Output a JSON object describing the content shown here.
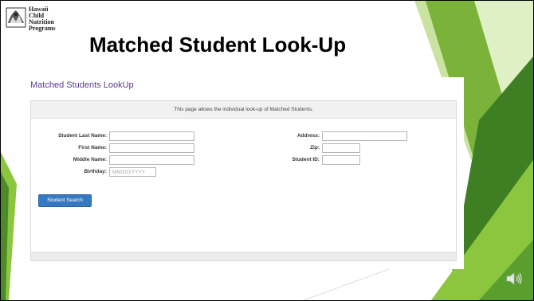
{
  "slide": {
    "title": "Matched Student Look-Up",
    "logo_lines": [
      "Hawaii",
      "Child",
      "Nutrition",
      "Programs"
    ]
  },
  "page": {
    "heading": "Matched Students LookUp",
    "panel_notice": "This page allows the individual look-up of Matched Students.",
    "fields": {
      "last_name": {
        "label": "Student Last Name:",
        "value": ""
      },
      "first_name": {
        "label": "First Name:",
        "value": ""
      },
      "middle_name": {
        "label": "Middle Name:",
        "value": ""
      },
      "birthday": {
        "label": "Birthday:",
        "placeholder": "MM/DD/YYYY"
      },
      "address": {
        "label": "Address:",
        "value": ""
      },
      "zip": {
        "label": "Zip:",
        "value": ""
      },
      "student_id": {
        "label": "Student ID:",
        "value": ""
      }
    },
    "search_button": "Student Search"
  },
  "icons": {
    "logo": "hawaii-cnp-logo-icon",
    "audio": "speaker-icon"
  },
  "colors": {
    "accent_green": "#8cc63f",
    "dark_green": "#4d8a2a",
    "button_blue": "#3579c0",
    "heading_purple": "#5b3a8a"
  }
}
